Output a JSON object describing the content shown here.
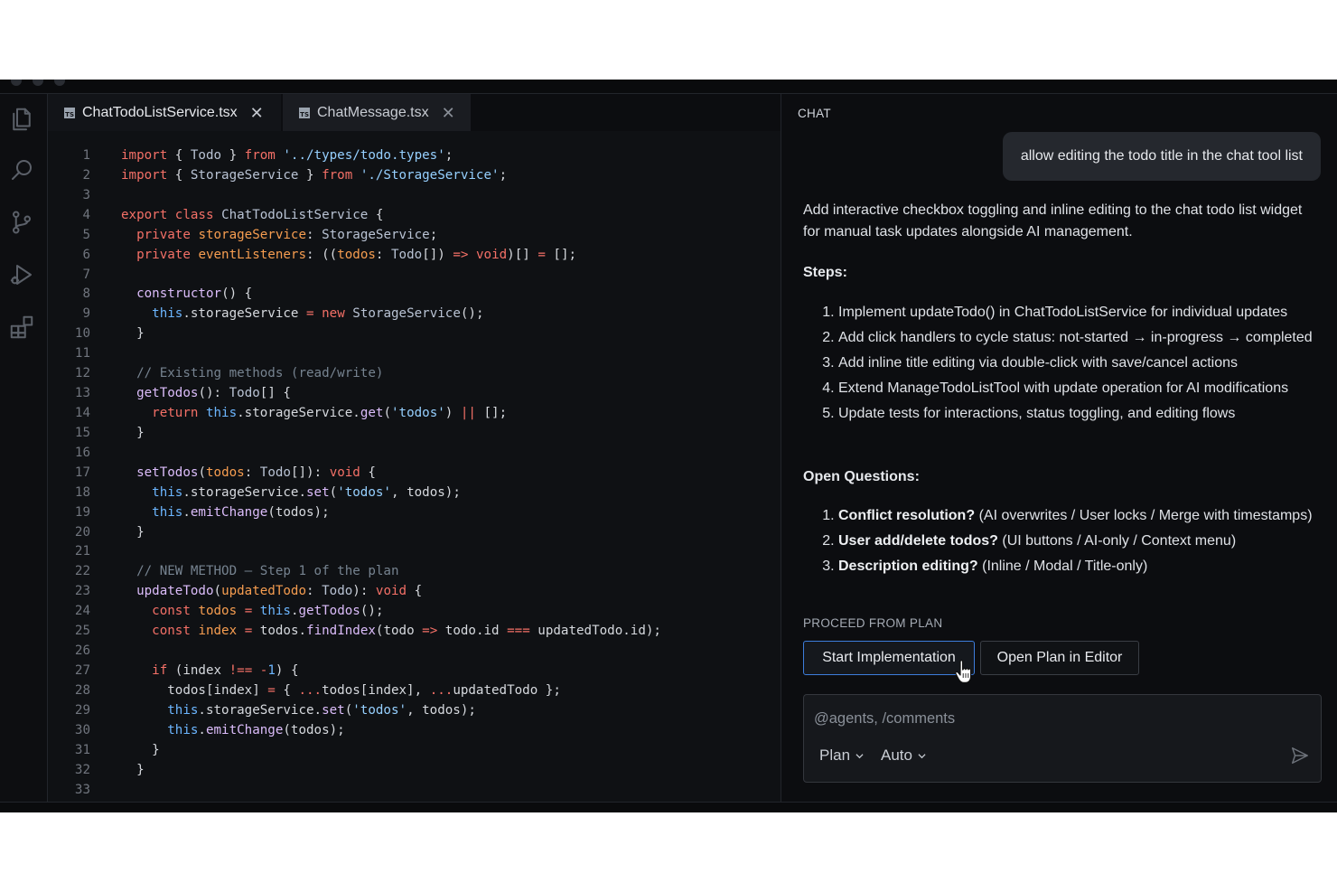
{
  "editor": {
    "tabs": [
      {
        "label": "ChatTodoListService.tsx",
        "icon": "ts-file-icon",
        "active": true
      },
      {
        "label": "ChatMessage.tsx",
        "icon": "ts-file-icon",
        "active": false
      }
    ],
    "line_numbers": [
      "1",
      "2",
      "3",
      "4",
      "5",
      "6",
      "7",
      "8",
      "9",
      "10",
      "11",
      "12",
      "13",
      "14",
      "15",
      "16",
      "17",
      "18",
      "19",
      "20",
      "21",
      "22",
      "23",
      "24",
      "25",
      "26",
      "27",
      "28",
      "29",
      "30",
      "31",
      "32",
      "33"
    ],
    "code_lines": [
      "import { Todo } from '../types/todo.types';",
      "import { StorageService } from './StorageService';",
      "",
      "export class ChatTodoListService {",
      "  private storageService: StorageService;",
      "  private eventListeners: ((todos: Todo[]) => void)[] = [];",
      "",
      "  constructor() {",
      "    this.storageService = new StorageService();",
      "  }",
      "",
      "  // Existing methods (read/write)",
      "  getTodos(): Todo[] {",
      "    return this.storageService.get('todos') || [];",
      "  }",
      "",
      "  setTodos(todos: Todo[]): void {",
      "    this.storageService.set('todos', todos);",
      "    this.emitChange(todos);",
      "  }",
      "",
      "  // NEW METHOD — Step 1 of the plan",
      "  updateTodo(updatedTodo: Todo): void {",
      "    const todos = this.getTodos();",
      "    const index = todos.findIndex(todo => todo.id === updatedTodo.id);",
      "",
      "    if (index !== -1) {",
      "      todos[index] = { ...todos[index], ...updatedTodo };",
      "      this.storageService.set('todos', todos);",
      "      this.emitChange(todos);",
      "    }",
      "  }",
      ""
    ]
  },
  "activity_bar": [
    "files-icon",
    "search-icon",
    "source-control-icon",
    "run-debug-icon",
    "extensions-icon"
  ],
  "chat": {
    "title": "CHAT",
    "user_message": "allow editing the todo title in the chat tool list",
    "summary": "Add interactive checkbox toggling and inline editing to the chat todo list widget for manual task updates alongside AI management.",
    "steps_heading": "Steps:",
    "steps": [
      "Implement updateTodo() in ChatTodoListService for individual updates",
      "Add click handlers to cycle status: not-started → in-progress → completed",
      "Add inline title editing via double-click with save/cancel actions",
      "Extend ManageTodoListTool with update operation for AI modifications",
      "Update tests for interactions, status toggling, and editing flows"
    ],
    "questions_heading": "Open Questions:",
    "questions": [
      {
        "title": "Conflict resolution?",
        "options": "(AI overwrites / User locks / Merge with timestamps)"
      },
      {
        "title": "User add/delete todos?",
        "options": "(UI buttons / AI-only / Context menu)"
      },
      {
        "title": "Description editing?",
        "options": "(Inline / Modal / Title-only)"
      }
    ],
    "proceed_label": "PROCEED FROM PLAN",
    "start_button": "Start Implementation",
    "open_plan_button": "Open Plan in Editor",
    "input_placeholder": "@agents, /comments",
    "mode_dropdown": "Plan",
    "model_dropdown": "Auto",
    "accent_color": "#3d7ddc"
  }
}
